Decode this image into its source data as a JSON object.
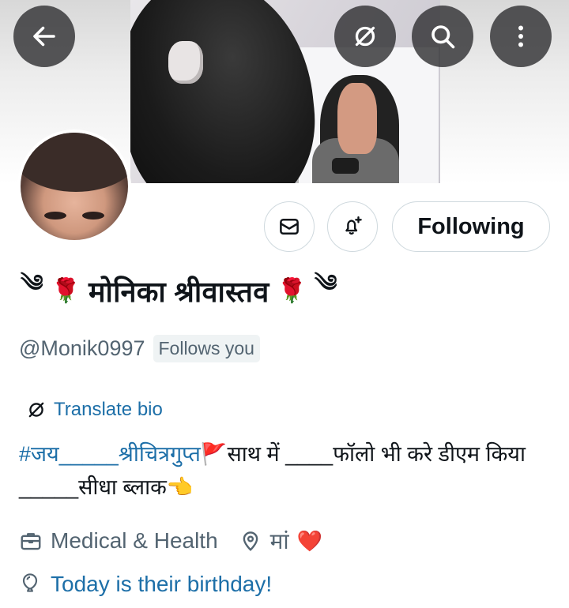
{
  "header": {
    "back_icon": "arrow-left-icon",
    "translate_icon": "translate-icon",
    "search_icon": "search-icon",
    "more_icon": "more-vertical-icon"
  },
  "profile": {
    "name_prefix": "༄",
    "rose": "🌹",
    "name": "मोनिका श्रीवास्तव",
    "name_suffix": "༄",
    "handle": "@Monik0997",
    "follows_you": "Follows you"
  },
  "actions": {
    "message_icon": "envelope-icon",
    "notify_icon": "bell-plus-icon",
    "following_label": "Following"
  },
  "bio": {
    "translate_label": "Translate bio",
    "hashtag": "#जय_____श्रीचित्रगुप्त",
    "text_part1": "🚩साथ में ____फॉलो भी करे  डीएम किया _____सीधा ब्लाक👈"
  },
  "meta": {
    "category_icon": "briefcase-icon",
    "category": "Medical & Health",
    "location_icon": "location-pin-icon",
    "location": "मां",
    "location_emoji": "❤️",
    "birthday_icon": "balloon-icon",
    "birthday": "Today is their birthday!"
  },
  "colors": {
    "accent": "#1d6fa8",
    "secondary_text": "#536471",
    "border": "#cfd9de"
  }
}
